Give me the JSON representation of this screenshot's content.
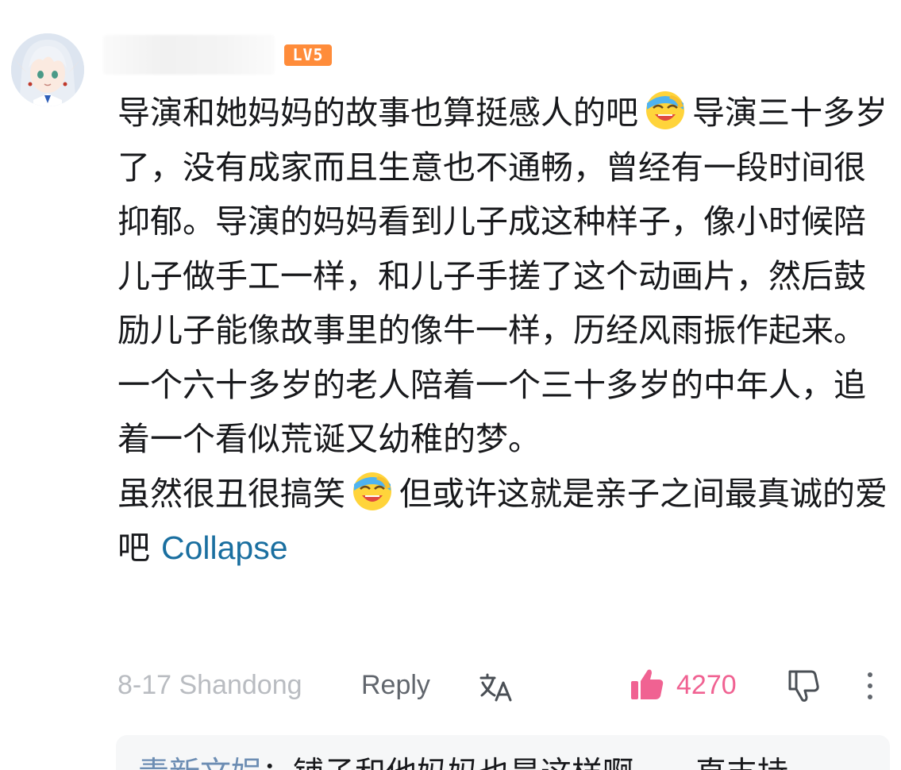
{
  "comment": {
    "level_badge": "LV5",
    "content": {
      "line1_a": "导演和她妈妈的故事也算挺感人的吧",
      "line1_b": "导演三十多岁了，没有成家而且生意也不通畅，曾经有一段时间很抑郁。导演的妈妈看到儿子成这种样子，像小时候陪儿子做手工一样，和儿子手搓了这个动画片，然后鼓励儿子能像故事里的像牛一样，历经风雨振作起来。一个六十多岁的老人陪着一个三十多岁的中年人，追着一个看似荒诞又幼稚的梦。",
      "line2_a": "虽然很丑很搞笑",
      "line2_b": "但或许这就是亲子之间最真诚的爱吧",
      "collapse_label": "Collapse"
    },
    "emoji_name": "laughing-crying-emoji",
    "meta": {
      "time_location": "8-17 Shandong",
      "reply_label": "Reply",
      "like_count": "4270"
    },
    "icons": {
      "translate": "translate-icon",
      "like": "thumbs-up-icon",
      "dislike": "thumbs-down-icon",
      "more": "more-vertical-icon"
    },
    "colors": {
      "like_accent": "#f06292",
      "link": "#1a6fa0",
      "badge": "#ff8c3a",
      "meta_text": "#b9bcc1"
    },
    "sub_reply_preview": {
      "name": "青新文娱",
      "text": "：铺子和他妈妈也是这样啊，一直支持"
    }
  }
}
